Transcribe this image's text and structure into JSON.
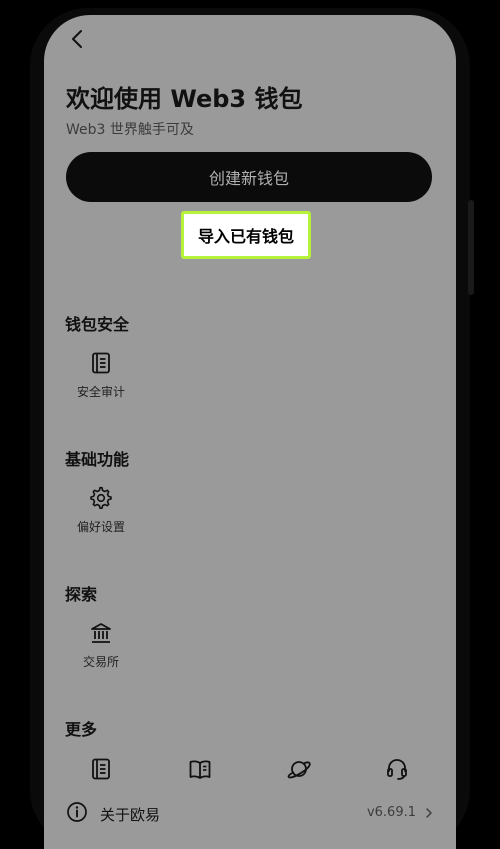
{
  "header": {
    "title": "欢迎使用 Web3 钱包",
    "subtitle": "Web3 世界触手可及"
  },
  "actions": {
    "create_wallet": "创建新钱包",
    "import_wallet": "导入已有钱包",
    "import_highlight_color": "#b7f23a"
  },
  "sections": {
    "security": {
      "title": "钱包安全",
      "items": [
        {
          "label": "安全审计",
          "icon": "document-icon"
        }
      ]
    },
    "basic": {
      "title": "基础功能",
      "items": [
        {
          "label": "偏好设置",
          "icon": "gear-icon"
        }
      ]
    },
    "explore": {
      "title": "探索",
      "items": [
        {
          "label": "交易所",
          "icon": "bank-icon"
        }
      ]
    },
    "more": {
      "title": "更多",
      "icons": [
        "document-list-icon",
        "book-icon",
        "planet-icon",
        "headset-icon"
      ]
    }
  },
  "footer": {
    "about_label": "关于欧易",
    "version": "v6.69.1"
  }
}
